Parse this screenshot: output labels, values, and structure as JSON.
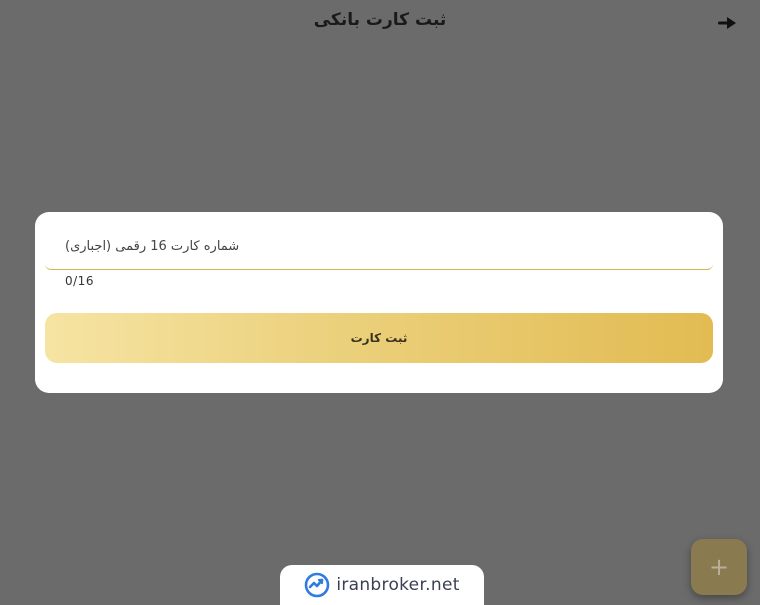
{
  "header": {
    "title": "ثبت کارت بانکی",
    "back_icon": "arrow-right-icon"
  },
  "card_form": {
    "card_number_field": {
      "value": "",
      "placeholder": "شماره کارت 16 رقمی (اجباری)"
    },
    "counter": "0/16",
    "submit_label": "ثبت کارت"
  },
  "fab": {
    "icon": "plus-icon",
    "glyph": "+"
  },
  "brand": {
    "logo_icon": "iranbroker-logo-icon",
    "text": "iranbroker.net"
  },
  "colors": {
    "overlay": "#6b6b6b",
    "accent_gold_start": "#f6e4a3",
    "accent_gold_end": "#e2bb52",
    "input_underline": "#d9b54a",
    "brand_blue": "#2f7be0"
  }
}
